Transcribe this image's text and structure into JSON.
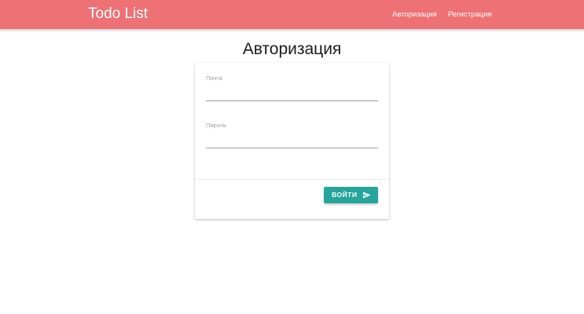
{
  "navbar": {
    "brand": "Todo List",
    "links": [
      {
        "label": "Авторизация"
      },
      {
        "label": "Регистрация"
      }
    ],
    "color": "#ee7176"
  },
  "page": {
    "title": "Авторизация"
  },
  "form": {
    "email": {
      "label": "Почта",
      "value": ""
    },
    "password": {
      "label": "Пароль",
      "value": ""
    },
    "submit": {
      "label": "Войти",
      "icon": "send-icon",
      "color": "#26a69a"
    }
  }
}
